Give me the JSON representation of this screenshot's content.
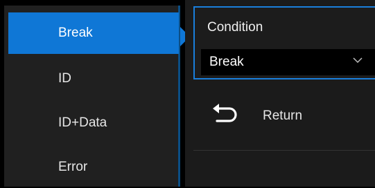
{
  "list": {
    "items": [
      {
        "label": "Break",
        "selected": true
      },
      {
        "label": "ID",
        "selected": false
      },
      {
        "label": "ID+Data",
        "selected": false
      },
      {
        "label": "Error",
        "selected": false
      }
    ]
  },
  "menu": {
    "condition_label": "Condition",
    "condition_value": "Break",
    "return_label": "Return"
  },
  "icons": {
    "dropdown": "chevron-down-icon",
    "return": "return-arrow-icon"
  },
  "colors": {
    "accent": "#0f77d6",
    "panel_border": "#1a7fdc",
    "background": "#000000",
    "panel_bg": "#1b1b1b"
  }
}
